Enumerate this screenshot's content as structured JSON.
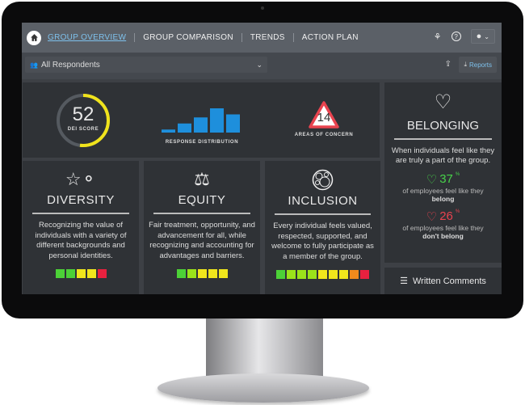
{
  "nav": {
    "items": [
      "GROUP OVERVIEW",
      "GROUP COMPARISON",
      "TRENDS",
      "ACTION PLAN"
    ],
    "active": "GROUP OVERVIEW",
    "icons": [
      "home-icon",
      "sprout-icon",
      "help-icon",
      "user-icon"
    ]
  },
  "filter": {
    "selected": "All Respondents",
    "reports_label": "Reports"
  },
  "summary": {
    "dei_score": "52",
    "dei_score_label": "DEI SCORE",
    "dei_score_value": 52,
    "dist_label": "RESPONSE DISTRIBUTION",
    "distribution": [
      1,
      3,
      5,
      8,
      6
    ],
    "concern_count": "14",
    "concern_label": "AREAS OF CONCERN"
  },
  "colors": {
    "accent": "#7ec1ec",
    "gauge": "#f0e31c",
    "dist": "#1e8fdc",
    "good": "#47d14a",
    "bad": "#e8434f"
  },
  "cards": [
    {
      "title": "DIVERSITY",
      "desc": "Recognizing the value of individuals with a variety of different backgrounds and personal identities.",
      "bars": [
        "#4cd137",
        "#4cd137",
        "#f0e61c",
        "#f0e61c",
        "#e8213f"
      ]
    },
    {
      "title": "EQUITY",
      "desc": "Fair treatment, opportunity, and advancement for all, while recognizing and accounting for advantages and barriers.",
      "bars": [
        "#4cd137",
        "#9be31a",
        "#f0e61c",
        "#f0e61c",
        "#f0e61c"
      ]
    },
    {
      "title": "INCLUSION",
      "desc": "Every individual feels valued, respected, supported, and welcome to fully participate as a member of the group.",
      "bars": [
        "#4cd137",
        "#9be31a",
        "#9be31a",
        "#9be31a",
        "#f0e61c",
        "#f0e61c",
        "#f0e61c",
        "#f08a1c",
        "#e8213f"
      ]
    }
  ],
  "belonging": {
    "title": "BELONGING",
    "desc": "When individuals feel like they are truly a part of the group.",
    "belong_pct": "37",
    "pct_sign": "%",
    "caption": "of employees feel like they",
    "belong": "belong",
    "not_pct": "26",
    "not_belong": "don't belong"
  },
  "comments": {
    "label": "Written Comments"
  }
}
